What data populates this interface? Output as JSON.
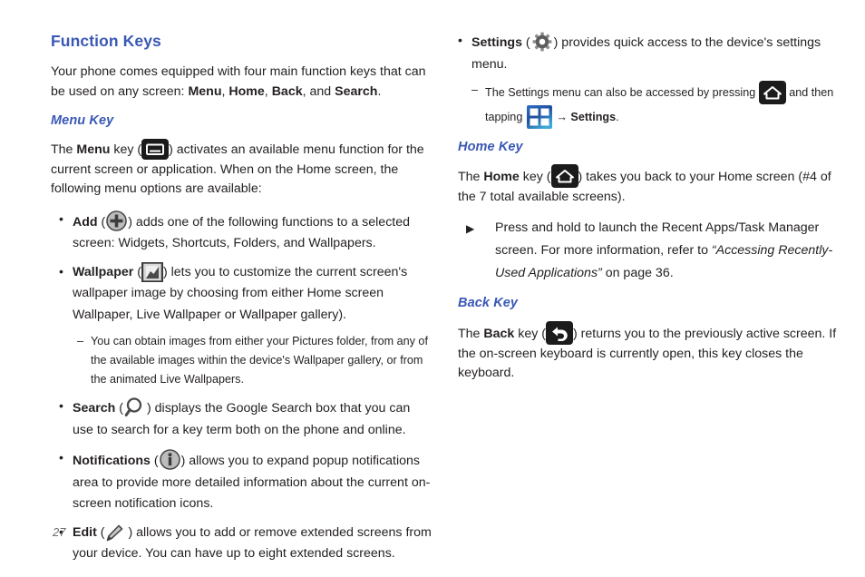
{
  "page": {
    "number": "27",
    "accent_color": "#3a58b5",
    "text_color": "#231f20",
    "background": "#ffffff"
  },
  "left_column": {
    "section_title": "Function Keys",
    "intro": {
      "pre": "Your phone comes equipped with four main function keys that can be used on any screen: ",
      "key1": "Menu",
      "sep1": ", ",
      "key2": "Home",
      "sep2": ", ",
      "key3": "Back",
      "sep3": ", and ",
      "key4": "Search",
      "post": "."
    },
    "menu_key": {
      "heading": "Menu Key",
      "para_pre": "The ",
      "para_bold": "Menu",
      "para_mid": " key (",
      "icon_name": "menu-key-icon",
      "para_post": ") activates an available menu function for the current screen or application. When on the Home screen, the following menu options are available:"
    },
    "bullets": [
      {
        "marker": "•",
        "label": "Add",
        "pre": " (",
        "icon_name": "add-circle-icon",
        "post": ") adds one of the following functions to a selected screen: Widgets, Shortcuts, Folders, and Wallpapers."
      },
      {
        "marker": "•",
        "label": "Wallpaper",
        "pre": " (",
        "icon_name": "wallpaper-picture-icon",
        "post": ") lets you to customize the current screen's wallpaper image by choosing from either Home screen Wallpaper, Live Wallpaper or Wallpaper gallery)."
      },
      {
        "marker": "•",
        "label": "Search",
        "pre": " (",
        "icon_name": "search-magnifier-icon",
        "post": ") displays the Google Search box that you can use to search for a key term both on the phone and online."
      },
      {
        "marker": "•",
        "label": "Notifications",
        "pre": " (",
        "icon_name": "notifications-info-icon",
        "post": ") allows you to expand popup notifications area to provide more detailed information about the current on-screen notification icons."
      },
      {
        "marker": "•",
        "label": "Edit",
        "pre": " (",
        "icon_name": "edit-pencil-icon",
        "post": ") allows you to add or remove extended screens from your device. You can have up to eight extended screens."
      }
    ],
    "wallpaper_note": {
      "marker": "–",
      "text": "You can obtain images from either your Pictures folder, from any of the available images within the device's Wallpaper gallery, or from the animated Live Wallpapers."
    }
  },
  "right_column": {
    "settings_bullet": {
      "marker": "•",
      "label": "Settings",
      "pre": " (",
      "icon_name": "settings-gear-icon",
      "post": ") provides quick access to the device's settings menu."
    },
    "settings_note": {
      "marker": "–",
      "pre": "The Settings menu can also be accessed by pressing ",
      "home_icon_name": "home-key-icon",
      "mid": " and then tapping ",
      "apps_icon_name": "apps-grid-icon",
      "arrow": "→",
      "bold_target": "Settings",
      "post": "."
    },
    "home_key": {
      "heading": "Home Key",
      "para_pre": "The ",
      "para_bold": "Home",
      "para_mid": " key (",
      "icon_name": "home-key-icon",
      "para_post": ") takes you back to your Home screen (#4 of the 7 total available screens).",
      "triangle_item": {
        "marker": "▶",
        "pre": "Press and hold to launch the Recent Apps/Task Manager screen. For more information, refer to ",
        "ref_title": "“Accessing Recently-Used Applications”",
        "post": " on page 36."
      }
    },
    "back_key": {
      "heading": "Back Key",
      "para_pre": "The ",
      "para_bold": "Back",
      "para_mid": " key (",
      "icon_name": "back-key-icon",
      "para_post": ") returns you to the previously active screen. If the on-screen keyboard is currently open, this key closes the keyboard."
    }
  }
}
